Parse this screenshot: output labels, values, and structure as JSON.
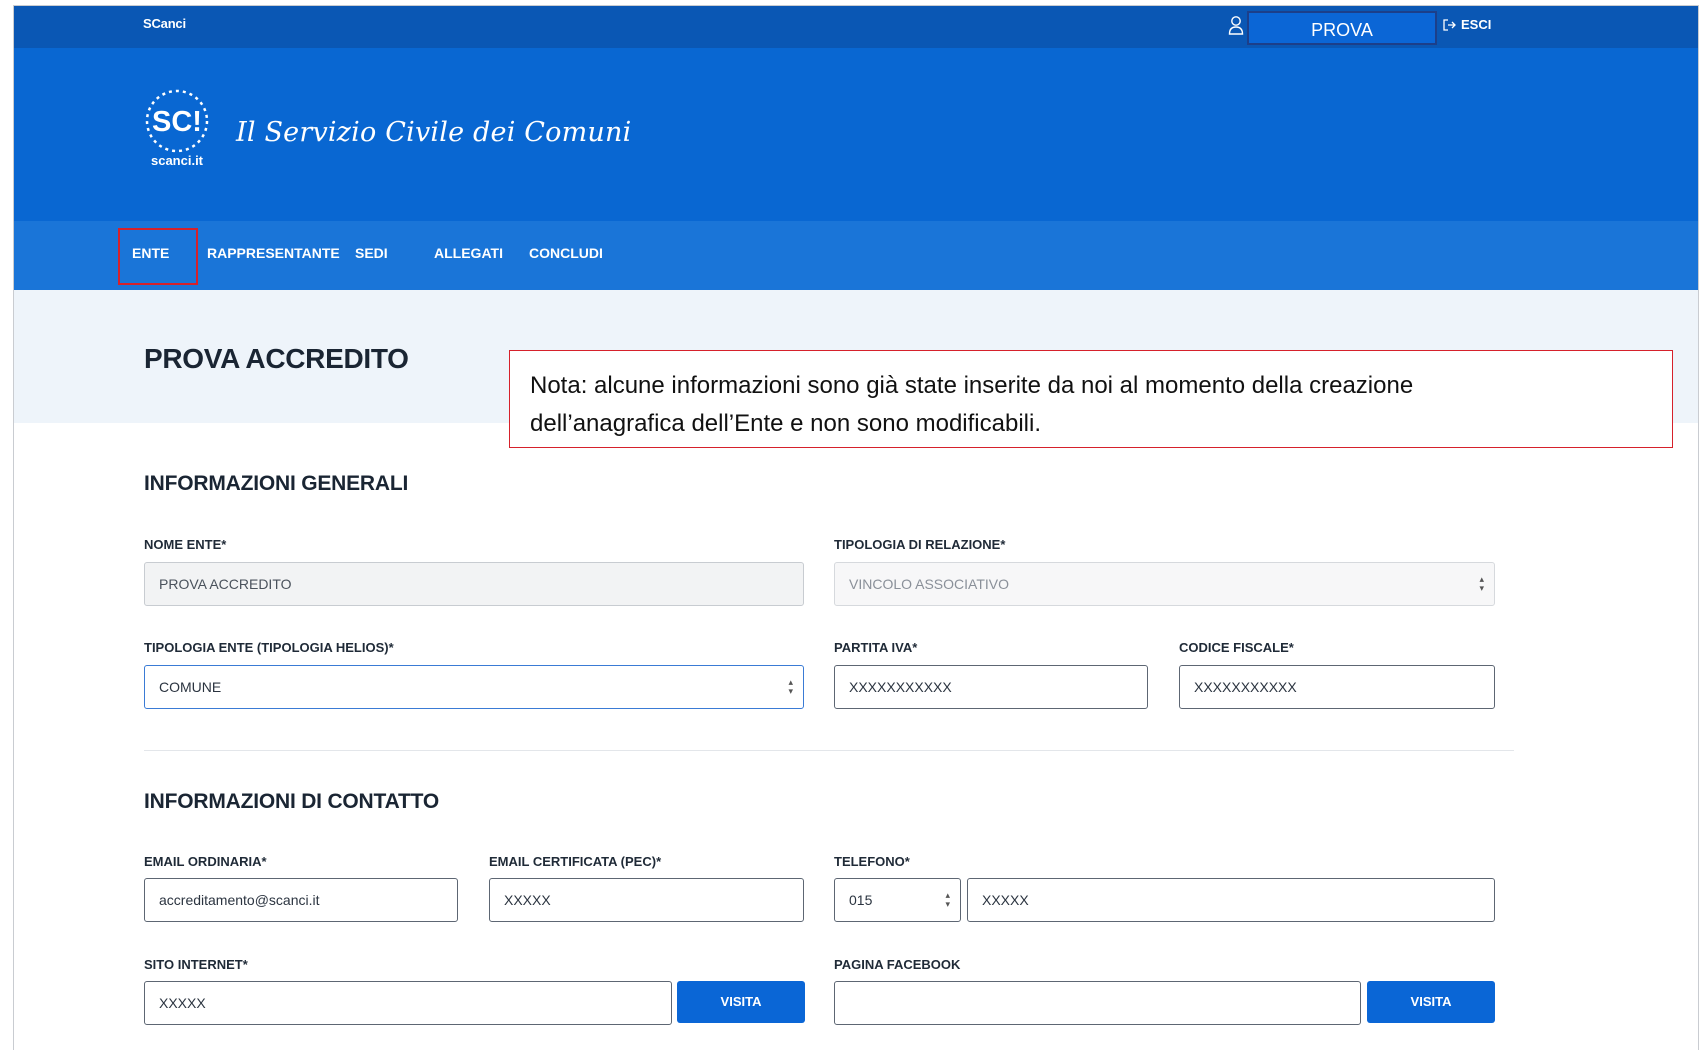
{
  "topbar": {
    "brand": "SCanci",
    "user_name": "PROVA",
    "logout_label": "ESCI"
  },
  "header": {
    "logo_text": "SC!",
    "logo_domain": "scanci.it",
    "site_title": "Il Servizio Civile dei Comuni"
  },
  "nav": {
    "items": [
      {
        "label": "ENTE",
        "active": true
      },
      {
        "label": "RAPPRESENTANTE"
      },
      {
        "label": "SEDI"
      },
      {
        "label": "ALLEGATI"
      },
      {
        "label": "CONCLUDI"
      }
    ]
  },
  "page": {
    "title": "PROVA ACCREDITO",
    "note_line1": "Nota: alcune informazioni sono già state inserite da noi al momento della creazione",
    "note_line2": "dell’anagrafica dell’Ente e non sono modificabili."
  },
  "general": {
    "title": "INFORMAZIONI GENERALI",
    "nome_ente_label": "NOME ENTE*",
    "nome_ente_value": "PROVA ACCREDITO",
    "tipologia_relazione_label": "TIPOLOGIA DI RELAZIONE*",
    "tipologia_relazione_value": "VINCOLO ASSOCIATIVO",
    "tipologia_ente_label": "TIPOLOGIA ENTE (TIPOLOGIA HELIOS)*",
    "tipologia_ente_value": "COMUNE",
    "partita_iva_label": "PARTITA IVA*",
    "partita_iva_value": "XXXXXXXXXXX",
    "codice_fiscale_label": "CODICE FISCALE*",
    "codice_fiscale_value": "XXXXXXXXXXX"
  },
  "contact": {
    "title": "INFORMAZIONI DI CONTATTO",
    "email_label": "EMAIL ORDINARIA*",
    "email_value": "accreditamento@scanci.it",
    "pec_label": "EMAIL CERTIFICATA (PEC)*",
    "pec_value": "XXXXX",
    "telefono_label": "TELEFONO*",
    "telefono_prefix": "015",
    "telefono_value": "XXXXX",
    "sito_label": "SITO INTERNET*",
    "sito_value": "XXXXX",
    "sito_button": "VISITA",
    "facebook_label": "PAGINA FACEBOOK",
    "facebook_value": "",
    "facebook_button": "VISITA"
  },
  "colors": {
    "topbar": "#0a57b4",
    "header": "#0967d2",
    "nav": "#1a75d8",
    "accent_red": "#d6212b",
    "button": "#0a66d6"
  }
}
